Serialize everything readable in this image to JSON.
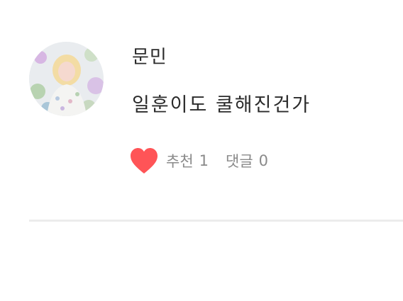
{
  "post": {
    "author": "문민",
    "message": "일훈이도 쿨해진건가",
    "recommend_label": "추천",
    "recommend_count": "1",
    "comment_label": "댓글",
    "comment_count": "0"
  },
  "icons": {
    "avatar": "avatar-photo",
    "like": "heart-icon"
  },
  "colors": {
    "heart": "#ff5457",
    "text": "#2b2b2b",
    "meta_text": "#8a8a8a",
    "divider": "#ececec"
  }
}
